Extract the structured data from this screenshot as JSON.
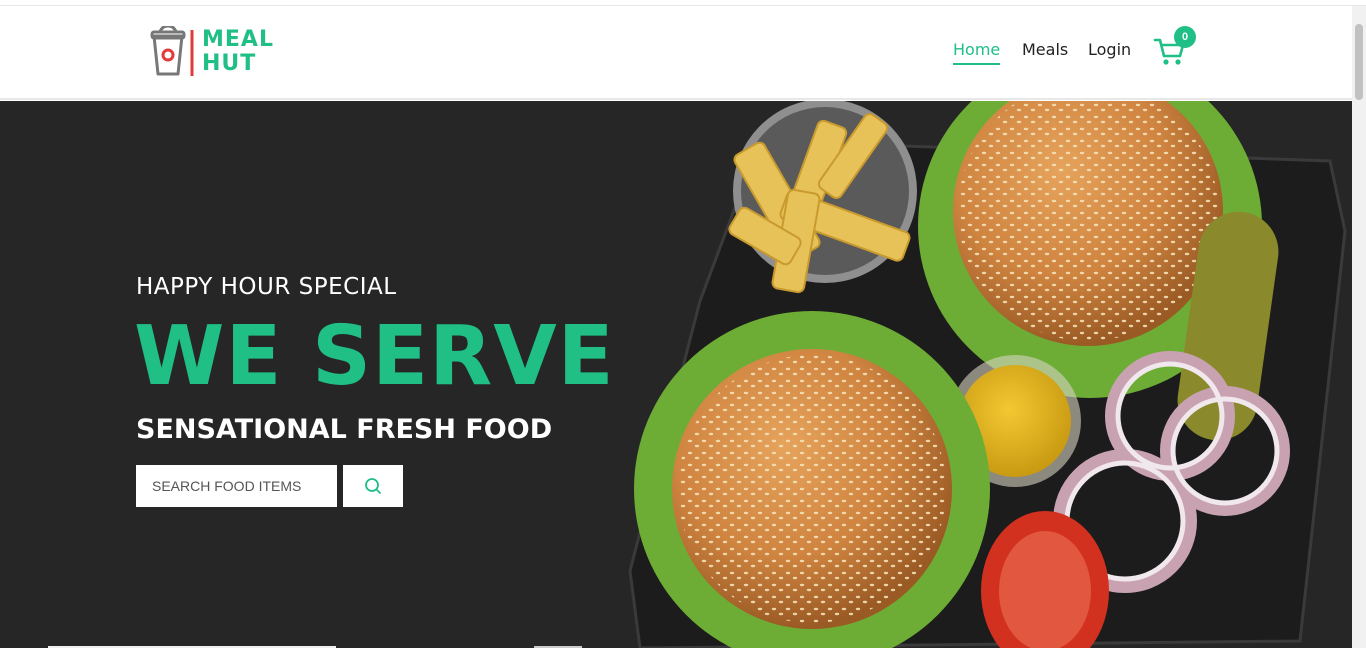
{
  "brand": {
    "logo_line1": "MEAL",
    "logo_line2": "HUT",
    "accent_color": "#1fbf86"
  },
  "nav": {
    "home": "Home",
    "meals": "Meals",
    "login": "Login",
    "cart_icon": "shopping-cart-icon",
    "cart_count": "0"
  },
  "hero": {
    "kicker": "HAPPY HOUR SPECIAL",
    "headline": "WE SERVE",
    "subhead": "SENSATIONAL FRESH FOOD",
    "search_placeholder": "SEARCH FOOD ITEMS",
    "search_icon": "search-icon",
    "background": "burgers-fries-photo"
  }
}
